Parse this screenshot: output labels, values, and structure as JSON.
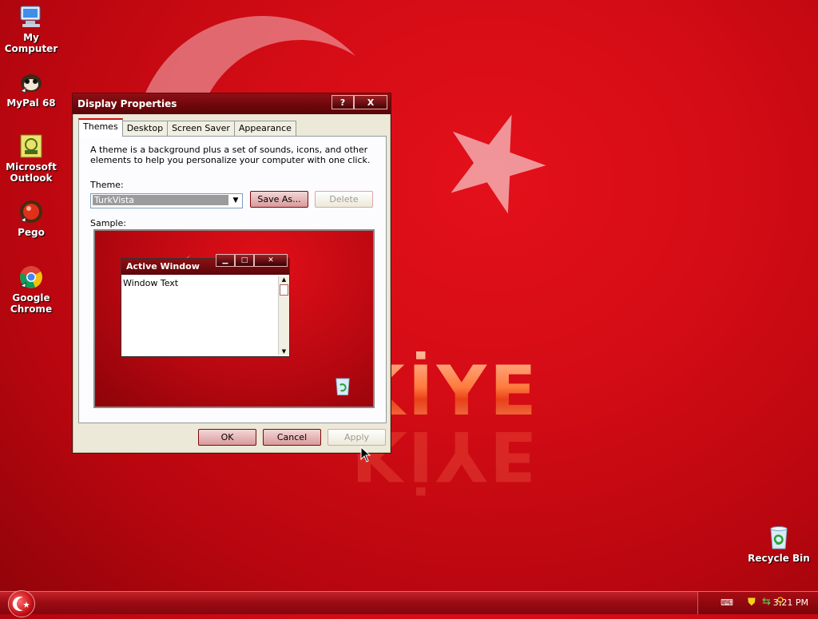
{
  "desktop_icons": [
    {
      "label": "My Computer",
      "icon": "computer-icon"
    },
    {
      "label": "MyPal 68",
      "icon": "mypal-icon"
    },
    {
      "label": "Microsoft Outlook",
      "icon": "outlook-icon"
    },
    {
      "label": "Pego",
      "icon": "pego-icon"
    },
    {
      "label": "Google Chrome",
      "icon": "chrome-icon"
    },
    {
      "label": "Recycle Bin",
      "icon": "recycle-bin-icon"
    }
  ],
  "wallpaper": {
    "text": "TÜRKİYE",
    "visible_text": "KİYE"
  },
  "dialog": {
    "title": "Display Properties",
    "help_label": "?",
    "close_label": "X",
    "tabs": [
      {
        "label": "Themes",
        "active": true
      },
      {
        "label": "Desktop",
        "active": false
      },
      {
        "label": "Screen Saver",
        "active": false
      },
      {
        "label": "Appearance",
        "active": false
      }
    ],
    "description": "A theme is a background plus a set of sounds, icons, and other elements to help you personalize your computer with one click.",
    "theme_label": "Theme:",
    "theme_value": "TurkVista",
    "save_as_label": "Save As...",
    "delete_label": "Delete",
    "sample_label": "Sample:",
    "sample": {
      "window_title": "Active Window",
      "window_text": "Window Text"
    },
    "ok_label": "OK",
    "cancel_label": "Cancel",
    "apply_label": "Apply"
  },
  "taskbar": {
    "clock": "3:21 PM",
    "tray_icons": [
      "keyboard-icon",
      "shield-icon",
      "network-icon",
      "search-icon"
    ]
  },
  "colors": {
    "accent": "#8c1015",
    "desktop": "#d40c15"
  }
}
